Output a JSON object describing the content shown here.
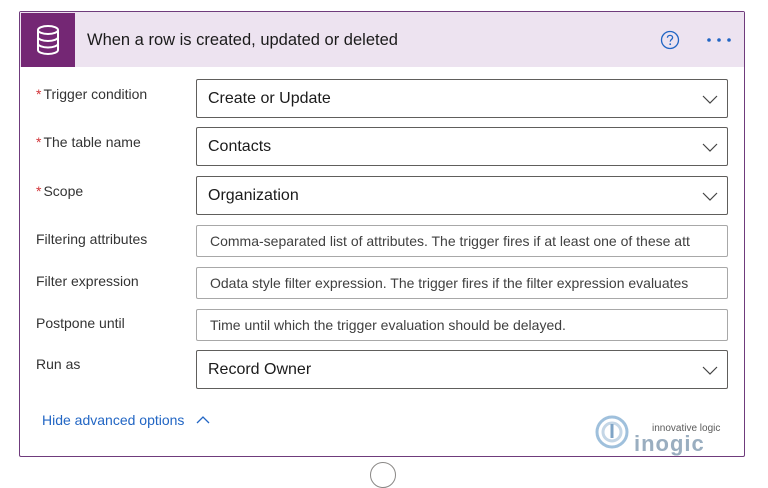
{
  "header": {
    "title": "When a row is created, updated or deleted",
    "icon": "database-icon",
    "help_icon": "help-circle-icon",
    "more_icon": "more-ellipsis-icon",
    "accent_color": "#742774"
  },
  "required_marker": "*",
  "fields": [
    {
      "label": "Trigger condition",
      "required": true,
      "type": "dropdown",
      "value": "Create or Update"
    },
    {
      "label": "The table name",
      "required": true,
      "type": "dropdown",
      "value": "Contacts"
    },
    {
      "label": "Scope",
      "required": true,
      "type": "dropdown",
      "value": "Organization"
    },
    {
      "label": "Filtering attributes",
      "required": false,
      "type": "text",
      "placeholder": "Comma-separated list of attributes. The trigger fires if at least one of these att"
    },
    {
      "label": "Filter expression",
      "required": false,
      "type": "text",
      "placeholder": "Odata style filter expression. The trigger fires if the filter expression evaluates"
    },
    {
      "label": "Postpone until",
      "required": false,
      "type": "text",
      "placeholder": "Time until which the trigger evaluation should be delayed."
    },
    {
      "label": "Run as",
      "required": false,
      "type": "dropdown",
      "value": "Record Owner"
    }
  ],
  "advanced_toggle": {
    "label": "Hide advanced options",
    "icon": "chevron-up-icon"
  },
  "watermark": {
    "tagline": "innovative logic",
    "brand": "inogic"
  }
}
